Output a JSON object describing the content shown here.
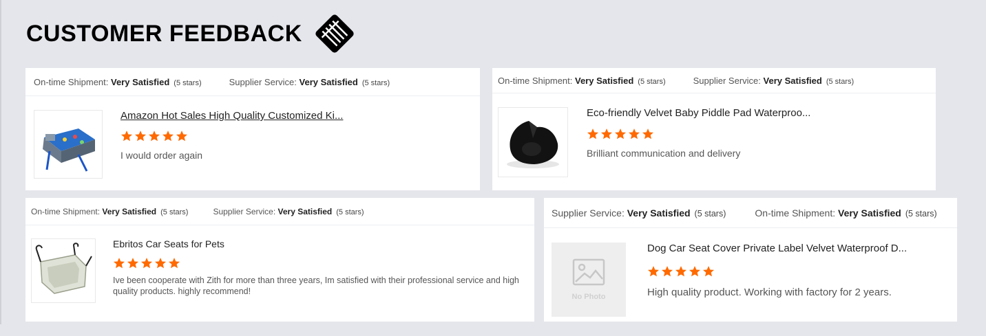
{
  "header": {
    "title": "CUSTOMER FEEDBACK",
    "icon": "handshake-icon"
  },
  "colors": {
    "background": "#e5e6eb",
    "star": "#ff6a00",
    "title": "#000000"
  },
  "cards": [
    {
      "metric1_label": "On-time Shipment:",
      "metric1_value": "Very Satisfied",
      "metric1_stars": "(5 stars)",
      "metric2_label": "Supplier Service:",
      "metric2_value": "Very Satisfied",
      "metric2_stars": "(5 stars)",
      "product_title": "Amazon Hot Sales High Quality Customized Ki...",
      "rating": 5,
      "comment": "I would order again",
      "thumb": "kids-travel-tray-icon"
    },
    {
      "metric1_label": "On-time Shipment:",
      "metric1_value": "Very Satisfied",
      "metric1_stars": "(5 stars)",
      "metric2_label": "Supplier Service:",
      "metric2_value": "Very Satisfied",
      "metric2_stars": "(5 stars)",
      "product_title": "Eco-friendly Velvet Baby Piddle Pad Waterproo...",
      "rating": 5,
      "comment": "Brilliant communication and delivery",
      "thumb": "piddle-pad-icon"
    },
    {
      "metric1_label": "On-time Shipment:",
      "metric1_value": "Very Satisfied",
      "metric1_stars": "(5 stars)",
      "metric2_label": "Supplier Service:",
      "metric2_value": "Very Satisfied",
      "metric2_stars": "(5 stars)",
      "product_title": "Ebritos Car Seats for Pets",
      "rating": 5,
      "comment": "Ive been cooperate with Zith for more than three years, Im satisfied with their professional service and high quality products. highly recommend!",
      "thumb": "pet-car-seat-icon"
    },
    {
      "metric1_label": "Supplier Service:",
      "metric1_value": "Very Satisfied",
      "metric1_stars": "(5 stars)",
      "metric2_label": "On-time Shipment:",
      "metric2_value": "Very Satisfied",
      "metric2_stars": "(5 stars)",
      "product_title": "Dog Car Seat Cover Private Label Velvet Waterproof D...",
      "rating": 5,
      "comment": "High quality product. Working with factory for 2 years.",
      "thumb_text": "No Photo",
      "thumb": "no-photo-placeholder-icon"
    }
  ]
}
